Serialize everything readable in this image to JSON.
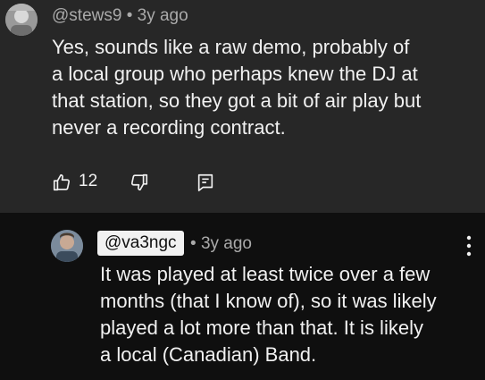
{
  "comments": [
    {
      "author": "@stews9",
      "separator": "•",
      "time": "3y ago",
      "lines": [
        "Yes, sounds like a raw demo, probably of",
        "a local group who perhaps knew the DJ at",
        "that station, so they got a bit of air play but",
        "never a recording contract."
      ],
      "likes": "12"
    },
    {
      "author": "@va3ngc",
      "separator": "•",
      "time": "3y ago",
      "lines": [
        "It was played at least twice over a few",
        "months (that I know of), so it was likely",
        "played a lot more than that.  It is likely",
        "a local (Canadian) Band."
      ]
    }
  ],
  "icons": {
    "like": "thumb-up-icon",
    "dislike": "thumb-down-icon",
    "reply": "reply-comment-icon",
    "more": "more-vert-icon"
  },
  "colors": {
    "top_bg": "#272727",
    "page_bg": "#0f0f0f",
    "text": "#f1f1f1",
    "meta": "#aaaaaa",
    "chip_bg": "#f1f1f1"
  }
}
